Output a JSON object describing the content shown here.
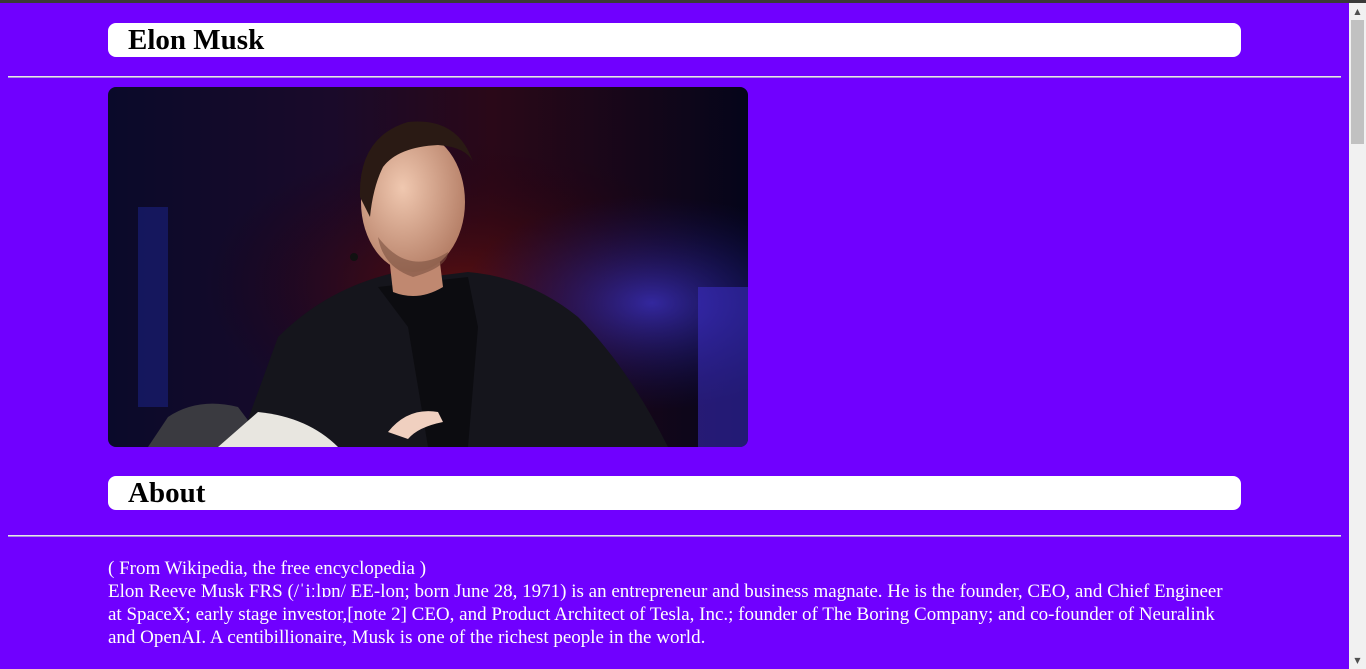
{
  "header": {
    "title": "Elon Musk"
  },
  "profile_image": {
    "alt": "Elon Musk portrait"
  },
  "about": {
    "heading": "About",
    "source": "( From Wikipedia, the free encyclopedia )",
    "text": "Elon Reeve Musk FRS (/ˈiːlɒn/ EE-lon; born June 28, 1971) is an entrepreneur and business magnate. He is the founder, CEO, and Chief Engineer at SpaceX; early stage investor,[note 2] CEO, and Product Architect of Tesla, Inc.; founder of The Boring Company; and co-founder of Neuralink and OpenAI. A centibillionaire, Musk is one of the richest people in the world."
  },
  "scrollbar": {
    "up_icon": "▲",
    "down_icon": "▼"
  },
  "colors": {
    "background": "#7000ff",
    "heading_box": "#ffffff",
    "text": "#ffffff"
  }
}
